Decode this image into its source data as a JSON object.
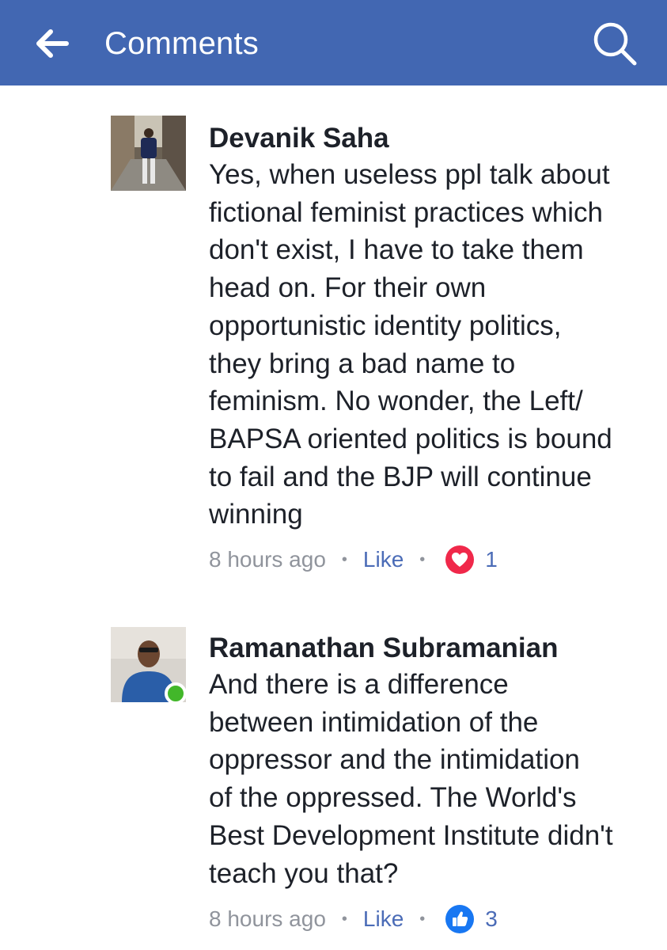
{
  "header": {
    "title": "Comments",
    "back_icon": "arrow-left-icon",
    "search_icon": "search-icon",
    "background_color": "#4267b2"
  },
  "comments": [
    {
      "author": "Devanik Saha",
      "lines": [
        "Yes, when  useless ppl talk about",
        "fictional feminist practices which",
        "don't exist, I have to take them",
        "head on. For their own",
        "opportunistic identity politics,",
        "they bring a bad name to",
        "feminism. No wonder, the Left/",
        "BAPSA oriented politics is bound",
        "to fail and the BJP will continue",
        "winning"
      ],
      "time": "8 hours ago",
      "like_label": "Like",
      "separator": "•",
      "reaction": "heart-icon",
      "reaction_color": "#f0284a",
      "reaction_count": "1",
      "online": false
    },
    {
      "author": "Ramanathan Subramanian",
      "lines": [
        "And there is a difference",
        "between intimidation of the",
        "oppressor and the intimidation",
        "of the oppressed. The World's",
        "Best Development Institute didn't",
        "teach you that?"
      ],
      "time": "8 hours ago",
      "like_label": "Like",
      "separator": "•",
      "reaction": "thumbs-up-icon",
      "reaction_color": "#1877f2",
      "reaction_count": "3",
      "online": true
    }
  ]
}
